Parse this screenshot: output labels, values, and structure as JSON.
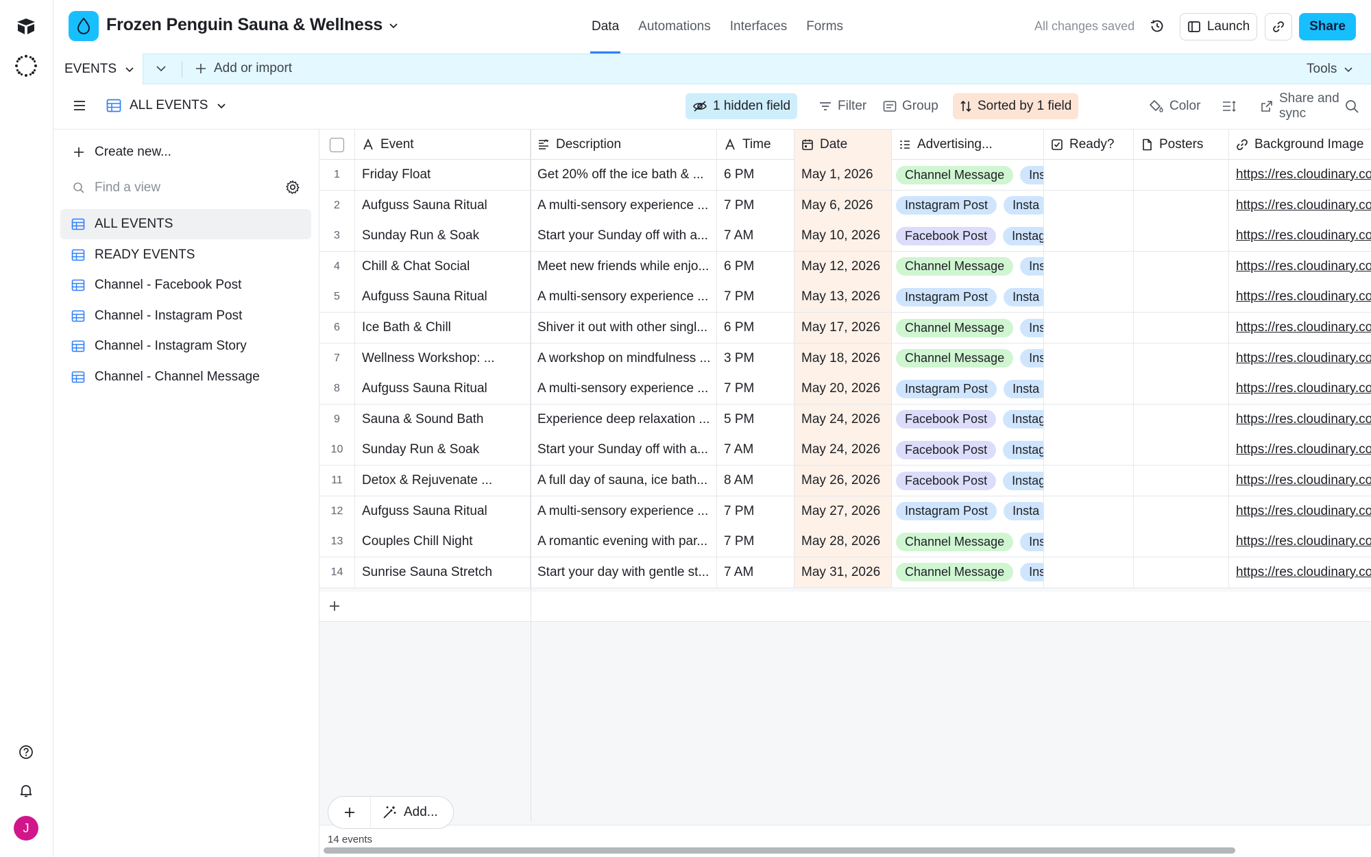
{
  "base": {
    "title": "Frozen Penguin Sauna & Wellness"
  },
  "nav": {
    "tabs": [
      "Data",
      "Automations",
      "Interfaces",
      "Forms"
    ],
    "active": "Data"
  },
  "header": {
    "saved_status": "All changes saved",
    "launch_label": "Launch",
    "share_label": "Share"
  },
  "tables": {
    "current": "EVENTS",
    "add_import_label": "Add or import",
    "tools_label": "Tools"
  },
  "viewbar": {
    "view_name": "ALL EVENTS",
    "hidden_fields": "1 hidden field",
    "filter": "Filter",
    "group": "Group",
    "sorted": "Sorted by 1 field",
    "color": "Color",
    "share_sync": "Share and sync"
  },
  "sidebar": {
    "create_label": "Create new...",
    "find_placeholder": "Find a view",
    "views": [
      "ALL EVENTS",
      "READY EVENTS",
      "Channel - Facebook Post",
      "Channel - Instagram Post",
      "Channel - Instagram Story",
      "Channel - Channel Message"
    ]
  },
  "grid": {
    "columns": [
      "Event",
      "Description",
      "Time",
      "Date",
      "Advertising...",
      "Ready?",
      "Posters",
      "Background Image"
    ],
    "rows": [
      {
        "n": "1",
        "event": "Friday Float",
        "desc": "Get 20% off the ice bath & ...",
        "time": "6 PM",
        "date": "May 1, 2026",
        "ad": "Channel Message",
        "ad2": "Ins",
        "url": "https://res.cloudinary.co"
      },
      {
        "n": "2",
        "event": "Aufguss Sauna Ritual",
        "desc": "A multi-sensory experience ...",
        "time": "7 PM",
        "date": "May 6, 2026",
        "ad": "Instagram Post",
        "ad2": "Insta",
        "url": "https://res.cloudinary.co"
      },
      {
        "n": "3",
        "event": "Sunday Run & Soak",
        "desc": "Start your Sunday off with a...",
        "time": "7 AM",
        "date": "May 10, 2026",
        "ad": "Facebook Post",
        "ad2": "Instag",
        "url": "https://res.cloudinary.co"
      },
      {
        "n": "4",
        "event": "Chill & Chat Social",
        "desc": "Meet new friends while enjo...",
        "time": "6 PM",
        "date": "May 12, 2026",
        "ad": "Channel Message",
        "ad2": "Ins",
        "url": "https://res.cloudinary.co"
      },
      {
        "n": "5",
        "event": "Aufguss Sauna Ritual",
        "desc": "A multi-sensory experience ...",
        "time": "7 PM",
        "date": "May 13, 2026",
        "ad": "Instagram Post",
        "ad2": "Insta",
        "url": "https://res.cloudinary.co"
      },
      {
        "n": "6",
        "event": "Ice Bath & Chill",
        "desc": "Shiver it out with other singl...",
        "time": "6 PM",
        "date": "May 17, 2026",
        "ad": "Channel Message",
        "ad2": "Ins",
        "url": "https://res.cloudinary.co"
      },
      {
        "n": "7",
        "event": "Wellness Workshop: ...",
        "desc": "A workshop on mindfulness ...",
        "time": "3 PM",
        "date": "May 18, 2026",
        "ad": "Channel Message",
        "ad2": "Ins",
        "url": "https://res.cloudinary.co"
      },
      {
        "n": "8",
        "event": "Aufguss Sauna Ritual",
        "desc": "A multi-sensory experience ...",
        "time": "7 PM",
        "date": "May 20, 2026",
        "ad": "Instagram Post",
        "ad2": "Insta",
        "url": "https://res.cloudinary.co"
      },
      {
        "n": "9",
        "event": "Sauna & Sound Bath",
        "desc": "Experience deep relaxation ...",
        "time": "5 PM",
        "date": "May 24, 2026",
        "ad": "Facebook Post",
        "ad2": "Instag",
        "url": "https://res.cloudinary.co"
      },
      {
        "n": "10",
        "event": "Sunday Run & Soak",
        "desc": "Start your Sunday off with a...",
        "time": "7 AM",
        "date": "May 24, 2026",
        "ad": "Facebook Post",
        "ad2": "Instag",
        "url": "https://res.cloudinary.co"
      },
      {
        "n": "11",
        "event": "Detox & Rejuvenate ...",
        "desc": "A full day of sauna, ice bath...",
        "time": "8 AM",
        "date": "May 26, 2026",
        "ad": "Facebook Post",
        "ad2": "Instag",
        "url": "https://res.cloudinary.co"
      },
      {
        "n": "12",
        "event": "Aufguss Sauna Ritual",
        "desc": "A multi-sensory experience ...",
        "time": "7 PM",
        "date": "May 27, 2026",
        "ad": "Instagram Post",
        "ad2": "Insta",
        "url": "https://res.cloudinary.co"
      },
      {
        "n": "13",
        "event": "Couples Chill Night",
        "desc": "A romantic evening with par...",
        "time": "7 PM",
        "date": "May 28, 2026",
        "ad": "Channel Message",
        "ad2": "Ins",
        "url": "https://res.cloudinary.co"
      },
      {
        "n": "14",
        "event": "Sunrise Sauna Stretch",
        "desc": "Start your day with gentle st...",
        "time": "7 AM",
        "date": "May 31, 2026",
        "ad": "Channel Message",
        "ad2": "Ins",
        "url": "https://res.cloudinary.co"
      }
    ],
    "add_label": "Add...",
    "record_count": "14 events"
  },
  "user": {
    "initial": "J"
  },
  "colors": {
    "accent": "#18bfff",
    "active_tab_underline": "#2d7ff9",
    "channel_message_pill": "#cff5d1",
    "instagram_post_pill": "#cfe5fd",
    "facebook_post_pill": "#dcdcfb",
    "sorted_highlight": "#fde4d5",
    "hidden_field_highlight": "#cfeefc",
    "avatar": "#d1168a"
  }
}
